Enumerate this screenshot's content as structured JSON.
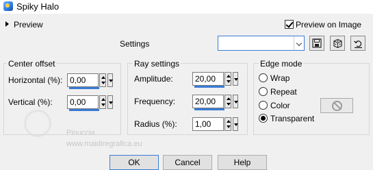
{
  "window": {
    "title": "Spiky Halo"
  },
  "preview": {
    "label": "Preview",
    "on_image_label": "Preview on Image",
    "on_image_checked": true
  },
  "settings": {
    "label": "Settings",
    "preset_value": ""
  },
  "icons": {
    "app": "app-icon",
    "save": "save-icon",
    "random": "dice-icon",
    "reset": "reset-icon",
    "transparent": "no-sign-icon"
  },
  "center_offset": {
    "legend": "Center offset",
    "horizontal_label": "Horizontal (%):",
    "horizontal_value": "0,00",
    "vertical_label": "Vertical (%):",
    "vertical_value": "0,00"
  },
  "ray_settings": {
    "legend": "Ray settings",
    "amplitude_label": "Amplitude:",
    "amplitude_value": "20,00",
    "frequency_label": "Frequency:",
    "frequency_value": "20,00",
    "radius_label": "Radius (%):",
    "radius_value": "1,00"
  },
  "edge_mode": {
    "legend": "Edge mode",
    "options": [
      "Wrap",
      "Repeat",
      "Color",
      "Transparent"
    ],
    "selected": "Transparent"
  },
  "watermark": {
    "name": "Pinuccia",
    "url": "www.maidiregrafica.eu"
  },
  "buttons": {
    "ok": "OK",
    "cancel": "Cancel",
    "help": "Help"
  },
  "colors": {
    "accent": "#3a7bd5",
    "window_bg": "#f0f0f0"
  }
}
